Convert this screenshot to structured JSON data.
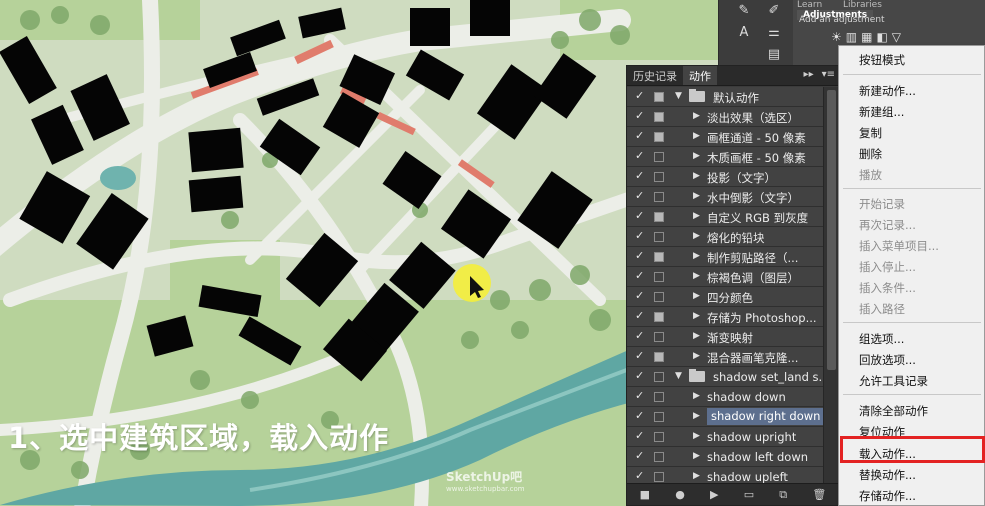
{
  "adjustments": {
    "tabs": [
      "Learn",
      "Libraries",
      "Adjustments"
    ],
    "hint": "Add an adjustment"
  },
  "actions_panel": {
    "tabs": [
      "历史记录",
      "动作"
    ],
    "controls": [
      "▸▸",
      "▾≡"
    ],
    "rows": [
      {
        "type": "set",
        "label": "默认动作",
        "checked": true,
        "dialog": true
      },
      {
        "type": "action",
        "label": "淡出效果（选区）",
        "checked": true,
        "dialog": true
      },
      {
        "type": "action",
        "label": "画框通道 - 50 像素",
        "checked": true,
        "dialog": true
      },
      {
        "type": "action",
        "label": "木质画框 - 50 像素",
        "checked": true,
        "dialog": false
      },
      {
        "type": "action",
        "label": "投影（文字）",
        "checked": true,
        "dialog": false
      },
      {
        "type": "action",
        "label": "水中倒影（文字）",
        "checked": true,
        "dialog": false
      },
      {
        "type": "action",
        "label": "自定义 RGB 到灰度",
        "checked": true,
        "dialog": true
      },
      {
        "type": "action",
        "label": "熔化的铅块",
        "checked": true,
        "dialog": false
      },
      {
        "type": "action",
        "label": "制作剪贴路径（...",
        "checked": true,
        "dialog": true
      },
      {
        "type": "action",
        "label": "棕褐色调（图层）",
        "checked": true,
        "dialog": false
      },
      {
        "type": "action",
        "label": "四分颜色",
        "checked": true,
        "dialog": false
      },
      {
        "type": "action",
        "label": "存储为 Photoshop...",
        "checked": true,
        "dialog": true
      },
      {
        "type": "action",
        "label": "渐变映射",
        "checked": true,
        "dialog": false
      },
      {
        "type": "action",
        "label": "混合器画笔克隆...",
        "checked": true,
        "dialog": true
      },
      {
        "type": "set",
        "label": "shadow set_land s...",
        "checked": true,
        "dialog": false
      },
      {
        "type": "action",
        "label": "shadow down",
        "checked": true,
        "dialog": false
      },
      {
        "type": "action",
        "label": "shadow right down",
        "checked": true,
        "dialog": false,
        "selected": true
      },
      {
        "type": "action",
        "label": "shadow upright",
        "checked": true,
        "dialog": false
      },
      {
        "type": "action",
        "label": "shadow left down",
        "checked": true,
        "dialog": false
      },
      {
        "type": "action",
        "label": "shadow upleft",
        "checked": true,
        "dialog": false
      }
    ]
  },
  "menu": {
    "items": [
      {
        "label": "按钮模式",
        "disabled": false
      },
      {
        "label": "新建动作...",
        "disabled": false
      },
      {
        "label": "新建组...",
        "disabled": false
      },
      {
        "label": "复制",
        "disabled": false
      },
      {
        "label": "删除",
        "disabled": false
      },
      {
        "label": "播放",
        "disabled": true
      },
      {
        "label": "开始记录",
        "disabled": true
      },
      {
        "label": "再次记录...",
        "disabled": true
      },
      {
        "label": "插入菜单项目...",
        "disabled": true
      },
      {
        "label": "插入停止...",
        "disabled": true
      },
      {
        "label": "插入条件...",
        "disabled": true
      },
      {
        "label": "插入路径",
        "disabled": true
      },
      {
        "label": "组选项...",
        "disabled": false
      },
      {
        "label": "回放选项...",
        "disabled": false
      },
      {
        "label": "允许工具记录",
        "disabled": false
      },
      {
        "label": "清除全部动作",
        "disabled": false
      },
      {
        "label": "复位动作",
        "disabled": false
      },
      {
        "label": "载入动作...",
        "disabled": false,
        "highlighted": true
      },
      {
        "label": "替换动作...",
        "disabled": false
      },
      {
        "label": "存储动作...",
        "disabled": false
      }
    ],
    "highlight_color": "#e32222"
  },
  "caption": "1、选中建筑区域，载入动作",
  "watermark": {
    "brand": "SketchUp吧",
    "url": "www.sketchupbar.com"
  },
  "colors": {
    "building": "#050505",
    "road": "#e6e8e2",
    "green": "#a9c98c",
    "river": "#5fa7a3",
    "accent": "#e07c6c"
  }
}
